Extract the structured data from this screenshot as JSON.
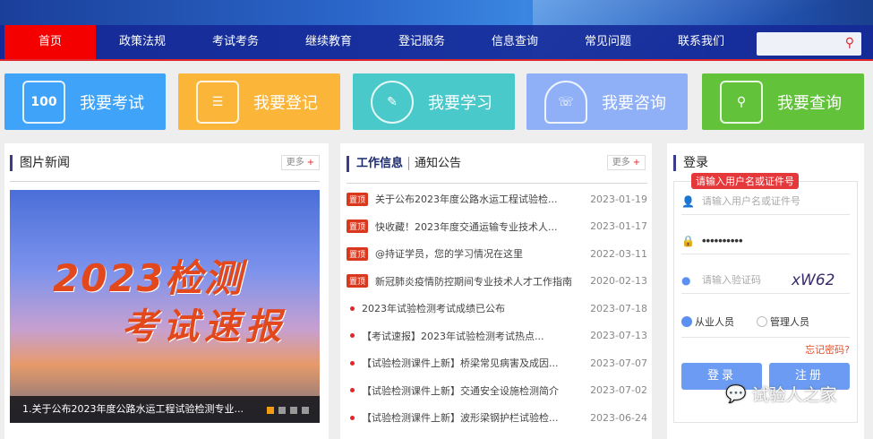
{
  "nav": {
    "items": [
      "首页",
      "政策法规",
      "考试考务",
      "继续教育",
      "登记服务",
      "信息查询",
      "常见问题",
      "联系我们"
    ],
    "search_placeholder": ""
  },
  "tiles": [
    {
      "label": "我要考试",
      "icon": "100",
      "color": "#3fa4f9"
    },
    {
      "label": "我要登记",
      "icon": "register-icon",
      "color": "#fbb63a"
    },
    {
      "label": "我要学习",
      "icon": "study-icon",
      "color": "#4ac9ca"
    },
    {
      "label": "我要咨询",
      "icon": "headset-icon",
      "color": "#8fb0f7"
    },
    {
      "label": "我要查询",
      "icon": "query-icon",
      "color": "#62c23a"
    }
  ],
  "photo_news": {
    "title": "图片新闻",
    "more": "更多",
    "slide_line1": "2023检测",
    "slide_line2": "考试速报",
    "caption": "1.关于公布2023年度公路水运工程试验检测专业..."
  },
  "work": {
    "tab_active": "工作信息",
    "tab_other": "通知公告",
    "more": "更多",
    "pin_label": "置顶",
    "items": [
      {
        "pinned": true,
        "title": "关于公布2023年度公路水运工程试验检...",
        "date": "2023-01-19"
      },
      {
        "pinned": true,
        "title": "快收藏！2023年度交通运输专业技术人...",
        "date": "2023-01-17"
      },
      {
        "pinned": true,
        "title": "@持证学员，您的学习情况在这里",
        "date": "2022-03-11"
      },
      {
        "pinned": true,
        "title": "新冠肺炎疫情防控期间专业技术人才工作指南",
        "date": "2020-02-13"
      },
      {
        "pinned": false,
        "title": "2023年试验检测考试成绩已公布",
        "date": "2023-07-18"
      },
      {
        "pinned": false,
        "title": "【考试速报】2023年试验检测考试热点...",
        "date": "2023-07-13"
      },
      {
        "pinned": false,
        "title": "【试验检测课件上新】桥梁常见病害及成因...",
        "date": "2023-07-07"
      },
      {
        "pinned": false,
        "title": "【试验检测课件上新】交通安全设施检测简介",
        "date": "2023-07-02"
      },
      {
        "pinned": false,
        "title": "【试验检测课件上新】波形梁钢护栏试验检...",
        "date": "2023-06-24"
      }
    ]
  },
  "login": {
    "title": "登录",
    "tooltip": "请输入用户名或证件号",
    "username_placeholder": "请输入用户名或证件号",
    "password_value": "••••••••••",
    "captcha_placeholder": "请输入验证码",
    "captcha_text": "xW62",
    "role_practitioner": "从业人员",
    "role_admin": "管理人员",
    "forgot": "忘记密码?",
    "login_btn": "登录",
    "register_btn": "注册"
  },
  "watermark": "试验人之家"
}
